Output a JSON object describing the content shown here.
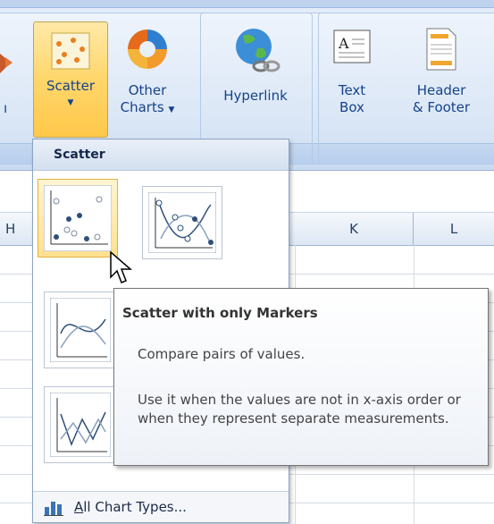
{
  "ribbon": {
    "scatter_label": "Scatter",
    "other_charts_line1": "Other",
    "other_charts_line2": "Charts",
    "hyperlink_label": "Hyperlink",
    "textbox_line1": "Text",
    "textbox_line2": "Box",
    "header_line1": "Header",
    "header_line2": "& Footer"
  },
  "columns": [
    "H",
    "K",
    "L"
  ],
  "dropdown": {
    "title": "Scatter",
    "items": [
      {
        "icon": "scatter-markers-only-icon",
        "hovered": true
      },
      {
        "icon": "scatter-smooth-lines-markers-icon",
        "hovered": false
      },
      {
        "icon": "scatter-smooth-lines-icon",
        "hovered": false
      },
      {
        "icon": "scatter-straight-lines-icon",
        "hovered": false
      }
    ],
    "footer_prefix": "A",
    "footer_label": "ll Chart Types..."
  },
  "tooltip": {
    "title": "Scatter with only Markers",
    "line1": "Compare pairs of values.",
    "line2": "Use it when the values are not in x-axis order or when they represent separate measurements."
  },
  "colors": {
    "ribbon_text": "#15428b",
    "hover_fill": "#ffd66b",
    "accent_orange": "#f29b2b"
  }
}
